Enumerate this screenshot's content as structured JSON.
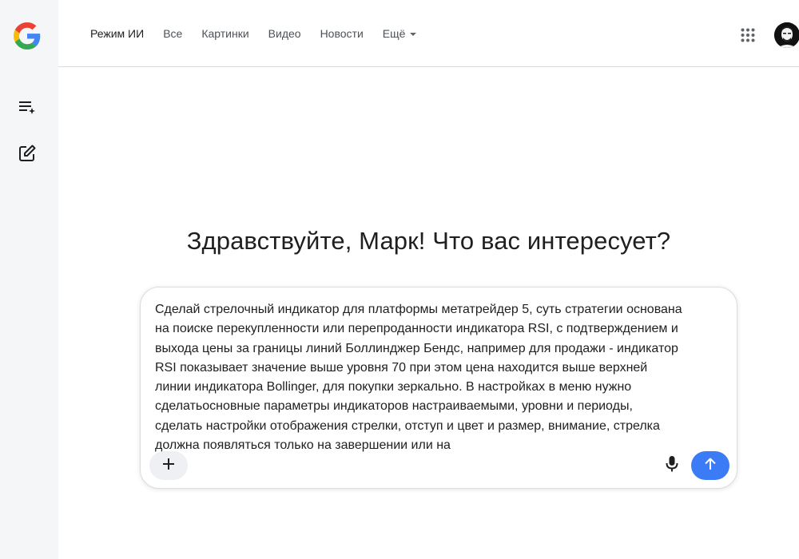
{
  "sidebar": {
    "logo_icon": "google-g-logo",
    "buttons": [
      {
        "icon": "playlist-add-sparkle-icon"
      },
      {
        "icon": "edit-square-icon"
      }
    ]
  },
  "header": {
    "tabs": [
      {
        "label": "Режим ИИ",
        "active": true
      },
      {
        "label": "Все"
      },
      {
        "label": "Картинки"
      },
      {
        "label": "Видео"
      },
      {
        "label": "Новости"
      },
      {
        "label": "Ещё",
        "dropdown": true
      }
    ],
    "apps_icon": "grid-apps-icon",
    "avatar_icon": "user-avatar"
  },
  "main": {
    "greeting": "Здравствуйте, Марк! Что вас интересует?"
  },
  "composer": {
    "text": "Сделай стрелочный индикатор для платформы метатрейдер 5, суть стратегии основана на поиске перекупленности или перепроданности индикатора RSI, с подтверждением и выхода цены за границы линий Боллинджер Бендс, например для продажи - индикатор RSI показывает значение выше уровня 70 при этом цена находится выше верхней линии индикатора Bollinger, для покупки зеркально. В настройках в меню нужно сделатьосновные параметры индикаторов настраиваемыми, уровни и периоды, сделать настройки отображения стрелки, отступ и цвет и размер, внимание, стрелка должна появляться только на завершении или на",
    "plus_icon": "plus-icon",
    "mic_icon": "microphone-icon",
    "send_icon": "arrow-up-icon"
  },
  "colors": {
    "sidebar_bg": "#f5f6f8",
    "send_button": "#3b7bf5",
    "plus_button_bg": "#eef0f3"
  }
}
